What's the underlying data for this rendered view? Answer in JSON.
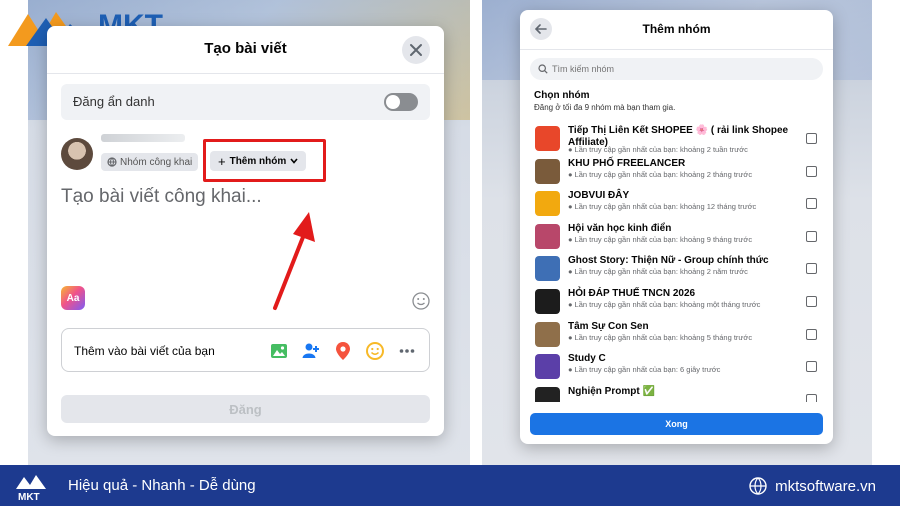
{
  "brand": {
    "logo_text": "MKT",
    "accent": "#1e5fb4"
  },
  "left_dialog": {
    "title": "Tạo bài viết",
    "anonymous_label": "Đăng ẩn danh",
    "anonymous_on": false,
    "privacy_label": "Nhóm công khai",
    "add_group_label": "Thêm nhóm",
    "placeholder": "Tạo bài viết công khai...",
    "format_label": "Aa",
    "add_to_post_label": "Thêm vào bài viết của bạn",
    "add_to_post_icons": [
      "photo-icon",
      "tag-people-icon",
      "location-icon",
      "feeling-icon",
      "more-icon"
    ],
    "post_button": "Đăng"
  },
  "right_dialog": {
    "title": "Thêm nhóm",
    "search_placeholder": "Tìm kiếm nhóm",
    "choose_title": "Chọn nhóm",
    "choose_subtitle": "Đăng ở tối đa 9 nhóm mà bạn tham gia.",
    "done_button": "Xong",
    "groups": [
      {
        "name": "Tiếp Thị Liên Kết SHOPEE 🌸 ( rải link Shopee Affiliate)",
        "meta": "Lần truy cập gần nhất của bạn: khoảng 2 tuần trước",
        "color": "#e8472a"
      },
      {
        "name": "KHU PHỐ FREELANCER",
        "meta": "Lần truy cập gần nhất của bạn: khoảng 2 tháng trước",
        "color": "#7a5b3b"
      },
      {
        "name": "JOBVUI ĐÂY",
        "meta": "Lần truy cập gần nhất của bạn: khoảng 12 tháng trước",
        "color": "#f2a90f"
      },
      {
        "name": "Hội văn học kinh điển",
        "meta": "Lần truy cập gần nhất của bạn: khoảng 9 tháng trước",
        "color": "#b8476a"
      },
      {
        "name": "Ghost Story: Thiện Nữ - Group chính thức",
        "meta": "Lần truy cập gần nhất của bạn: khoảng 2 năm trước",
        "color": "#3e6fb5"
      },
      {
        "name": "HỎI ĐÁP THUẾ TNCN 2026",
        "meta": "Lần truy cập gần nhất của bạn: khoảng một tháng trước",
        "color": "#1c1c1c"
      },
      {
        "name": "Tâm Sự Con Sen",
        "meta": "Lần truy cập gần nhất của bạn: khoảng 5 tháng trước",
        "color": "#8f6f4a"
      },
      {
        "name": "Study C",
        "meta": "Lần truy cập gần nhất của bạn: 6 giây trước",
        "color": "#5b3fa8"
      },
      {
        "name": "Nghiện Prompt ✅",
        "meta": "",
        "color": "#222222"
      }
    ]
  },
  "footer": {
    "logo_text": "MKT",
    "tagline": "Hiệu quả - Nhanh - Dễ dùng",
    "website": "mktsoftware.vn"
  }
}
